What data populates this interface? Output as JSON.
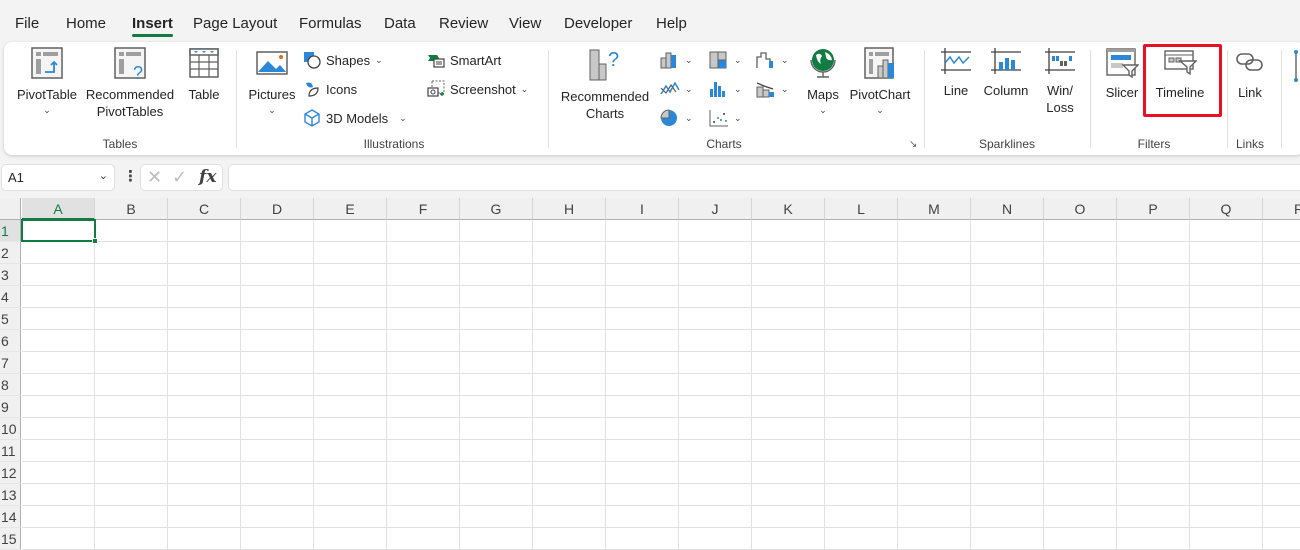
{
  "menu": {
    "tabs": [
      {
        "label": "File"
      },
      {
        "label": "Home"
      },
      {
        "label": "Insert",
        "active": true
      },
      {
        "label": "Page Layout"
      },
      {
        "label": "Formulas"
      },
      {
        "label": "Data"
      },
      {
        "label": "Review"
      },
      {
        "label": "View"
      },
      {
        "label": "Developer"
      },
      {
        "label": "Help"
      }
    ]
  },
  "ribbon": {
    "tables": {
      "label": "Tables",
      "pivottable": "PivotTable",
      "recommended_pivottables_1": "Recommended",
      "recommended_pivottables_2": "PivotTables",
      "table": "Table"
    },
    "illustrations": {
      "label": "Illustrations",
      "pictures": "Pictures",
      "shapes": "Shapes",
      "icons": "Icons",
      "models3d": "3D Models",
      "smartart": "SmartArt",
      "screenshot": "Screenshot"
    },
    "charts": {
      "label": "Charts",
      "recommended_1": "Recommended",
      "recommended_2": "Charts",
      "maps": "Maps",
      "pivotchart": "PivotChart"
    },
    "sparklines": {
      "label": "Sparklines",
      "line": "Line",
      "column": "Column",
      "winloss_1": "Win/",
      "winloss_2": "Loss"
    },
    "filters": {
      "label": "Filters",
      "slicer": "Slicer",
      "timeline": "Timeline"
    },
    "links": {
      "label": "Links",
      "link": "Link"
    },
    "highlight_color": "#e81123"
  },
  "formula_bar": {
    "name_box": "A1",
    "fx_label": "fx",
    "formula_value": ""
  },
  "sheet": {
    "columns": [
      "A",
      "B",
      "C",
      "D",
      "E",
      "F",
      "G",
      "H",
      "I",
      "J",
      "K",
      "L",
      "M",
      "N",
      "O",
      "P",
      "Q",
      "R"
    ],
    "rows": [
      "1",
      "2",
      "3",
      "4",
      "5",
      "6",
      "7",
      "8",
      "9",
      "10",
      "11",
      "12",
      "13",
      "14",
      "15"
    ],
    "active_cell": "A1",
    "accent_color": "#107c41"
  }
}
